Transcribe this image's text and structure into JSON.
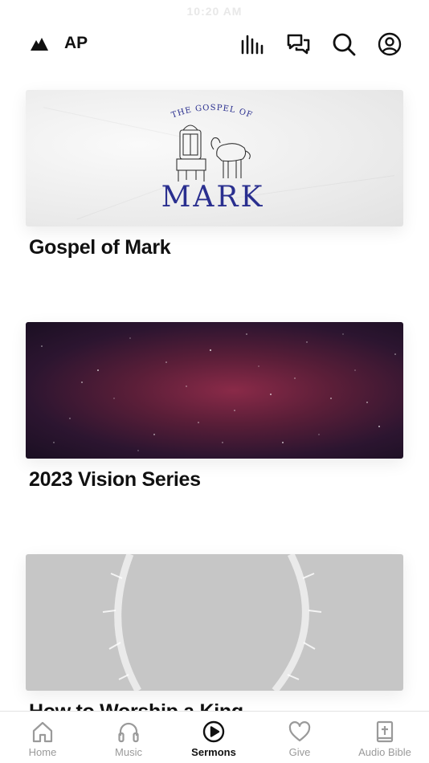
{
  "status_bar": {
    "time": "10:20 AM"
  },
  "header": {
    "brand": "AP",
    "icons": [
      "equalizer-icon",
      "chat-icon",
      "search-icon",
      "account-icon"
    ]
  },
  "cards": [
    {
      "title": "Gospel of Mark",
      "image": {
        "kicker": "THE GOSPEL OF",
        "headline": "MARK"
      }
    },
    {
      "title": "2023 Vision Series"
    },
    {
      "title": "How to Worship a King"
    }
  ],
  "tabs": [
    {
      "label": "Home",
      "icon": "home-icon",
      "active": false
    },
    {
      "label": "Music",
      "icon": "headphones-icon",
      "active": false
    },
    {
      "label": "Sermons",
      "icon": "play-circle-icon",
      "active": true
    },
    {
      "label": "Give",
      "icon": "heart-icon",
      "active": false
    },
    {
      "label": "Audio Bible",
      "icon": "bible-icon",
      "active": false
    }
  ],
  "colors": {
    "accent_text": "#111111",
    "inactive_tab": "#9a9a9a",
    "mark_blue": "#2a2f8f"
  }
}
